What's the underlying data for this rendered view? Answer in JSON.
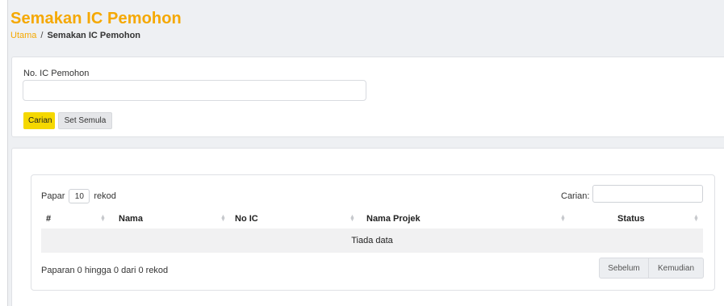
{
  "header": {
    "title": "Semakan IC Pemohon",
    "breadcrumb": {
      "home": "Utama",
      "separator": "/",
      "current": "Semakan IC Pemohon"
    }
  },
  "filter": {
    "ic_label": "No. IC Pemohon",
    "ic_value": "",
    "search_button": "Carian",
    "reset_button": "Set Semula"
  },
  "table": {
    "length_prefix": "Papar",
    "length_value": "10",
    "length_suffix": "rekod",
    "search_label": "Carian:",
    "search_value": "",
    "columns": [
      "#",
      "Nama",
      "No IC",
      "Nama Projek",
      "Status"
    ],
    "empty_text": "Tiada data",
    "info": "Paparan 0 hingga 0 dari 0 rekod",
    "prev": "Sebelum",
    "next": "Kemudian"
  },
  "colors": {
    "accent": "#f5a800",
    "button_yellow": "#f5d800"
  },
  "icons": {
    "sort": "sort-arrows-icon"
  }
}
